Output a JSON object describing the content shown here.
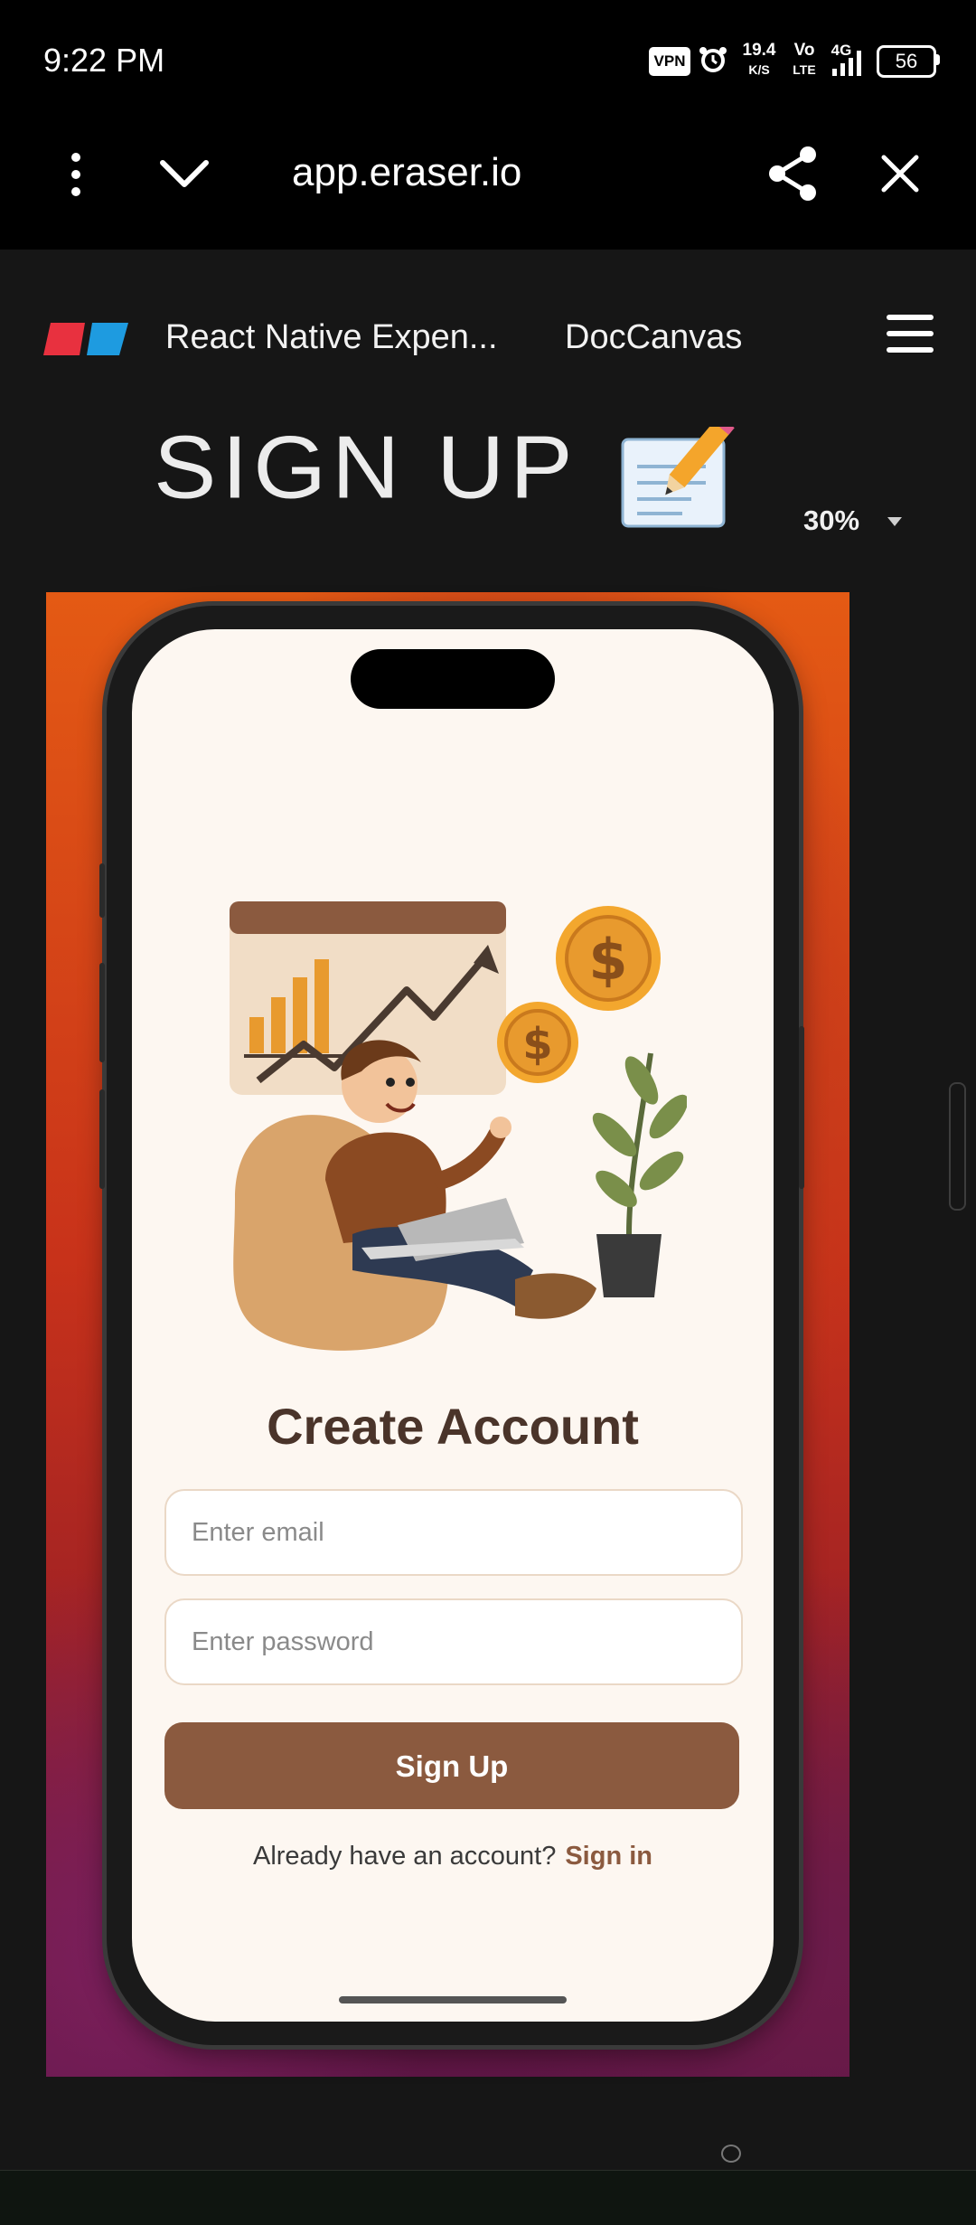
{
  "status_bar": {
    "time": "9:22 PM",
    "vpn": "VPN",
    "net_speed_value": "19.4",
    "net_speed_unit": "K/S",
    "volte_top": "Vo",
    "volte_bottom": "LTE",
    "network": "4G",
    "battery": "56"
  },
  "browser": {
    "url": "app.eraser.io",
    "icons": [
      "more-vert-icon",
      "chevron-down-icon",
      "share-icon",
      "close-icon"
    ]
  },
  "app_header": {
    "document_title": "React Native Expen...",
    "tab_label": "DocCanvas",
    "icons": [
      "eraser-logo",
      "hamburger-menu-icon"
    ]
  },
  "canvas": {
    "heading": "SIGN UP",
    "heading_emoji": "📝",
    "zoom": "30%"
  },
  "mockup": {
    "title": "Create Account",
    "email_placeholder": "Enter email",
    "password_placeholder": "Enter password",
    "signup_button": "Sign Up",
    "account_prompt": "Already have an account?",
    "signin_link": "Sign in",
    "illustration_icon": "person-laptop-finance-illustration"
  },
  "colors": {
    "brand_red": "#e8313f",
    "brand_blue": "#1e9be0",
    "button_brown": "#8b5a3f",
    "title_brown": "#4a342a",
    "screen_bg": "#fdf7f1"
  }
}
